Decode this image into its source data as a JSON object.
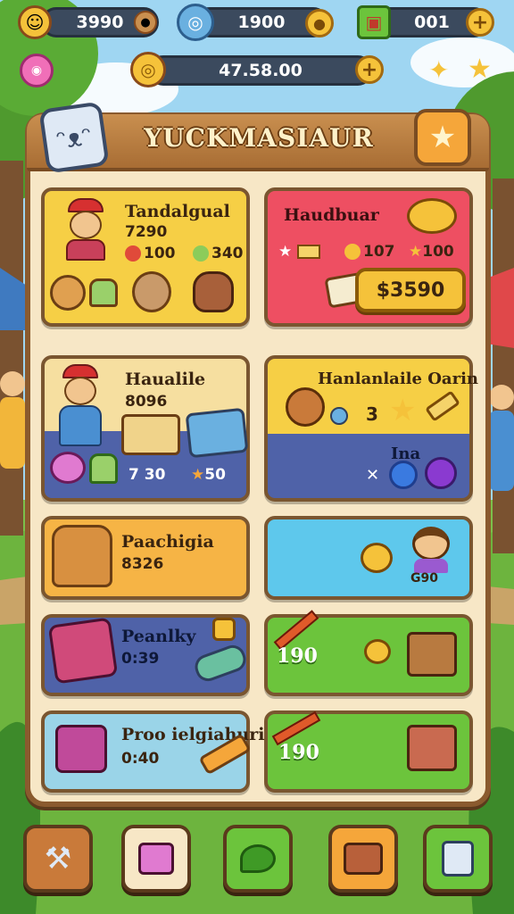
{
  "hud": {
    "coins": "3990",
    "gems": "1900",
    "crates": "001",
    "balance": "47.58.00",
    "plus": "+"
  },
  "header": {
    "title": "YUCKMASIAUR"
  },
  "cards": [
    {
      "title": "Tandalgual",
      "sub": "7290",
      "stat1": "100",
      "stat2": "340"
    },
    {
      "title": "Haudbuar",
      "stat1": "107",
      "stat2": "100",
      "price": "$3590"
    },
    {
      "title": "Haualile",
      "sub": "8096",
      "stat1": "7 30",
      "stat2": "50"
    },
    {
      "title": "Hanlanlaile Oarin",
      "stat1": "3",
      "sub2": "Ina"
    },
    {
      "title": "Paachigia",
      "sub": "8326"
    },
    {
      "title": "",
      "sub": "G90"
    },
    {
      "title": "Peanlky",
      "sub": "0:39"
    },
    {
      "title": "",
      "sub": "190"
    },
    {
      "title": "Proo ielgiahuri",
      "sub": "0:40"
    },
    {
      "title": "",
      "sub": "190"
    }
  ],
  "colors": {
    "yellow": "#f6cf45",
    "red": "#ee4f62",
    "blue": "#4f62a8",
    "orange": "#f6b445",
    "cyan": "#5ec8ec",
    "green": "#6cc43c",
    "wood": "#8a5a2e"
  },
  "nav": [
    "hammer-icon",
    "gift-box-icon",
    "chat-bubble-icon",
    "treasure-chest-icon",
    "game-console-icon"
  ]
}
